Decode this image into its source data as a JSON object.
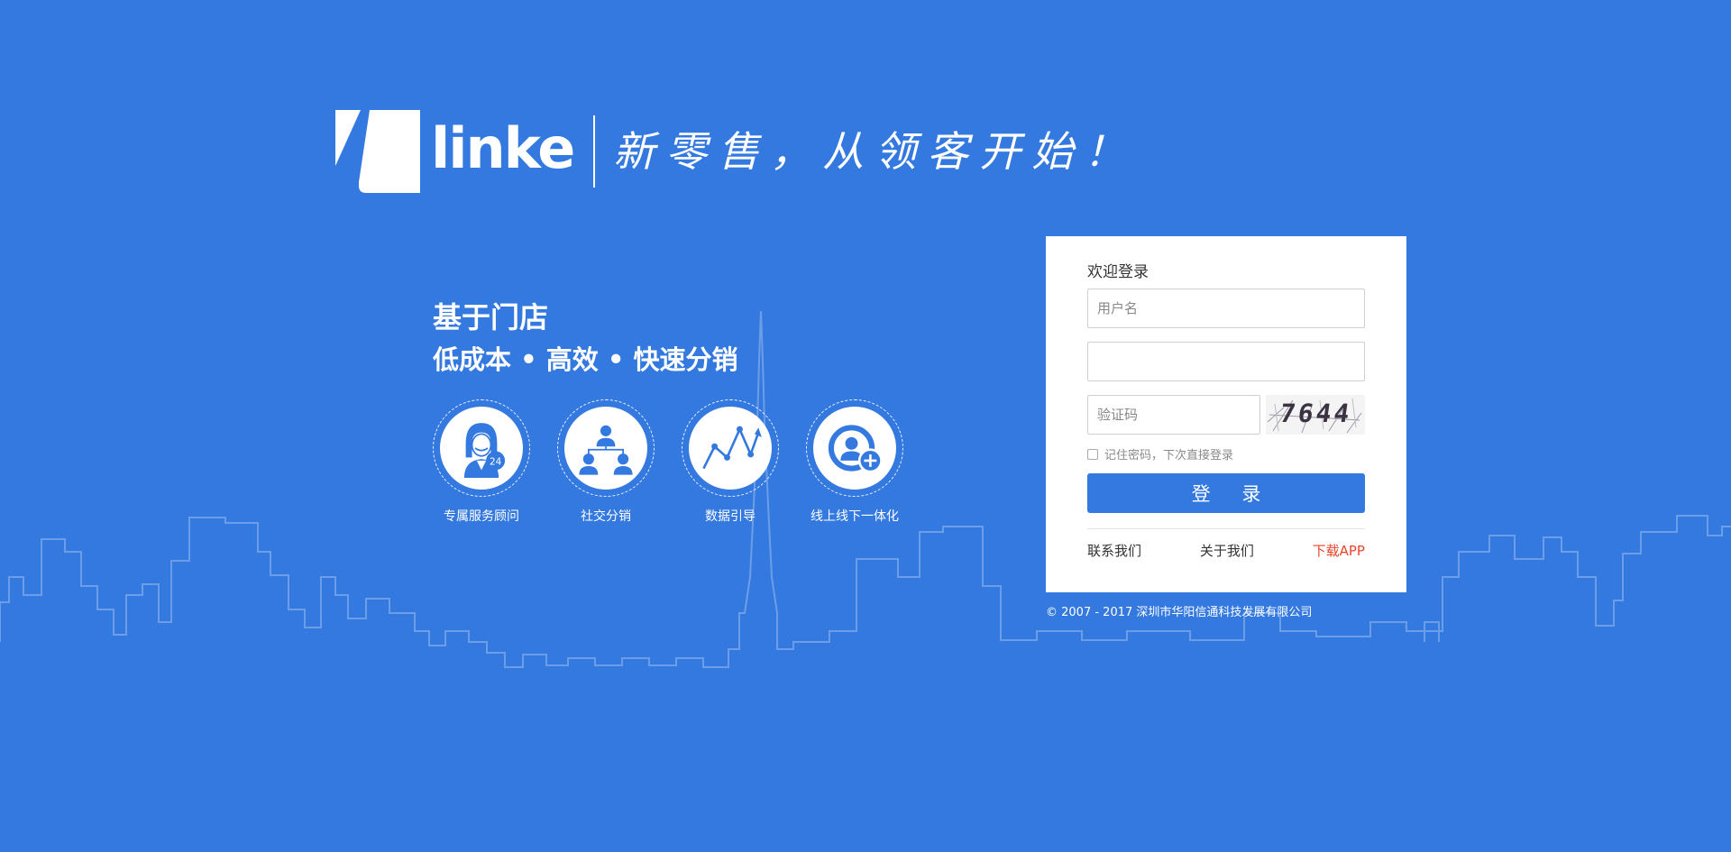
{
  "brand": {
    "name": "linke",
    "slogan": "新零售，从领客开始！"
  },
  "hero": {
    "title": "基于门店",
    "subtitle": "低成本 • 高效 • 快速分销"
  },
  "features": [
    {
      "label": "专属服务顾问",
      "icon": "customer-service-24h-icon"
    },
    {
      "label": "社交分销",
      "icon": "social-network-icon"
    },
    {
      "label": "数据引导",
      "icon": "data-chart-icon"
    },
    {
      "label": "线上线下一体化",
      "icon": "user-add-icon"
    }
  ],
  "login": {
    "title": "欢迎登录",
    "username_placeholder": "用户名",
    "password_placeholder": "",
    "captcha_placeholder": "验证码",
    "captcha_code": "7644",
    "remember_label": "记住密码，下次直接登录",
    "submit_label": "登 录",
    "links": {
      "contact": "联系我们",
      "about": "关于我们",
      "download": "下载APP"
    }
  },
  "footer": {
    "copyright": "© 2007 - 2017 深圳市华阳信通科技发展有限公司"
  },
  "colors": {
    "background": "#3479df",
    "primary": "#3479df",
    "download_link": "#e8452c"
  }
}
